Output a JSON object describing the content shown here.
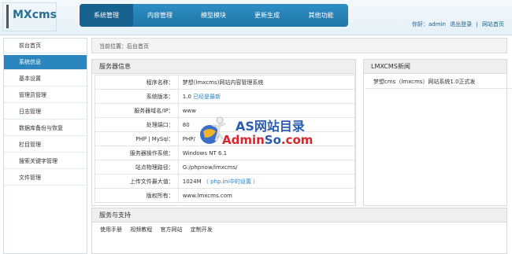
{
  "app": {
    "logo": "MXcms"
  },
  "nav": {
    "tabs": [
      "系统管理",
      "内容管理",
      "模型模块",
      "更新生成",
      "其他功能"
    ]
  },
  "userbar": {
    "greeting": "你好：admin",
    "logout": "退出登录",
    "separator": "|",
    "site_home": "网站首页"
  },
  "sidebar": {
    "items": [
      "前台首页",
      "系统信息",
      "基本设置",
      "管理员管理",
      "日志管理",
      "数据库备份与恢复",
      "栏目管理",
      "搜索关键字管理",
      "文件管理"
    ]
  },
  "breadcrumb": {
    "text": "当前位置：后台首页"
  },
  "server_info": {
    "title": "服务器信息",
    "rows": [
      {
        "label": "程序名称：",
        "value": "梦想(lmxcms)网站内容管理系统",
        "extra": ""
      },
      {
        "label": "系统版本：",
        "value": "1.0",
        "extra": "已经是最新"
      },
      {
        "label": "服务器域名/IP：",
        "value": "www",
        "extra": ""
      },
      {
        "label": "处理端口：",
        "value": "80",
        "extra": ""
      },
      {
        "label": "PHP | MySql：",
        "value": "PHP/",
        "extra": ""
      },
      {
        "label": "服务器操作系统：",
        "value": "Windows NT 6.1",
        "extra": ""
      },
      {
        "label": "站点物理路径：",
        "value": "G:/phpnow/lmxcms/",
        "extra": ""
      },
      {
        "label": "上传文件最大值：",
        "value": "1024M",
        "extra": "（ php.ini中的设置 ）"
      },
      {
        "label": "版权所有：",
        "value": "www.lmxcms.com",
        "extra": ""
      }
    ]
  },
  "news": {
    "title": "LMXCMS新闻",
    "items": [
      "梦想cms（lmxcms）网站系统1.0正式发"
    ]
  },
  "support": {
    "title": "服务与支持",
    "links": [
      "使用手册",
      "视频教程",
      "官方网站",
      "定制开发"
    ]
  },
  "watermark": {
    "line1": "AS网站目录",
    "line2_red": "Admin",
    "line2_blue": "So",
    "line2_end": ".com"
  },
  "colors": {
    "accent": "#2b86bd",
    "nav": "#1f75a8",
    "link": "#2b83c3"
  }
}
